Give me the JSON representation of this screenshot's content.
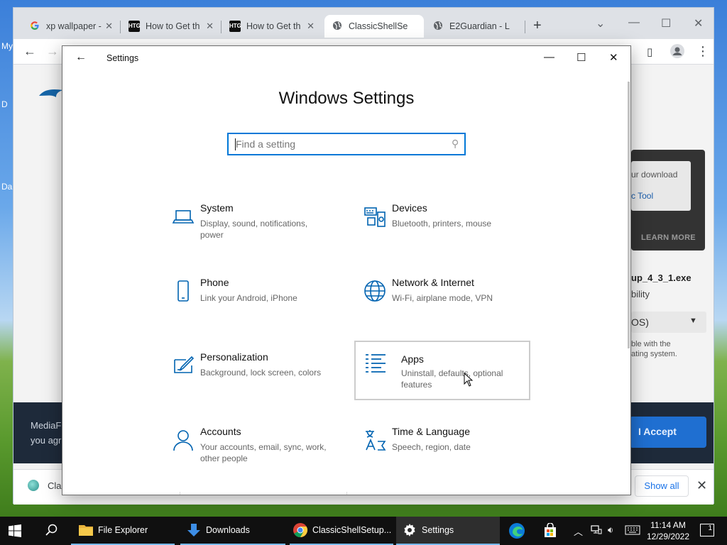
{
  "desktop": {
    "strip_texts": [
      "My",
      "D",
      "Da"
    ]
  },
  "browser": {
    "tabs": [
      {
        "label": "xp wallpaper -",
        "icon": "google-icon"
      },
      {
        "label": "How to Get th",
        "icon": "htg-icon"
      },
      {
        "label": "How to Get th",
        "icon": "htg-icon"
      },
      {
        "label": "ClassicShellSe",
        "icon": "globe-icon"
      },
      {
        "label": "E2Guardian - L",
        "icon": "globe-icon"
      }
    ],
    "htg_badge": "HTG",
    "page": {
      "ad_text": "ur download",
      "ad_link": "c Tool",
      "learn_more": "LEARN MORE",
      "download_name": "up_4_3_1.exe",
      "download_sub": "bility",
      "os_select": "OS)",
      "note_line1": "ble with the",
      "note_line2": "ating system.",
      "consent_line1": "MediaF",
      "consent_line2": "you agr",
      "accept_label": "I Accept"
    },
    "download_bar": {
      "file_label": "Clas",
      "show_all": "Show all"
    }
  },
  "settings": {
    "title": "Settings",
    "heading": "Windows Settings",
    "search_placeholder": "Find a setting",
    "tiles": [
      {
        "name": "System",
        "desc": "Display, sound, notifications, power",
        "icon": "laptop-icon"
      },
      {
        "name": "Devices",
        "desc": "Bluetooth, printers, mouse",
        "icon": "devices-icon"
      },
      {
        "name": "Phone",
        "desc": "Link your Android, iPhone",
        "icon": "phone-icon"
      },
      {
        "name": "Network & Internet",
        "desc": "Wi-Fi, airplane mode, VPN",
        "icon": "globe-icon"
      },
      {
        "name": "Personalization",
        "desc": "Background, lock screen, colors",
        "icon": "paint-icon"
      },
      {
        "name": "Apps",
        "desc": "Uninstall, defaults, optional features",
        "icon": "apps-list-icon"
      },
      {
        "name": "Accounts",
        "desc": "Your accounts, email, sync, work, other people",
        "icon": "person-icon"
      },
      {
        "name": "Time & Language",
        "desc": "Speech, region, date",
        "icon": "time-language-icon"
      }
    ]
  },
  "taskbar": {
    "apps": [
      {
        "label": "File Explorer",
        "icon": "folder-icon"
      },
      {
        "label": "Downloads",
        "icon": "download-arrow-icon"
      },
      {
        "label": "ClassicShellSetup...",
        "icon": "chrome-icon"
      },
      {
        "label": "Settings",
        "icon": "gear-icon"
      }
    ],
    "clock": {
      "time": "11:14 AM",
      "date": "12/29/2022"
    },
    "notification_count": "1"
  },
  "colors": {
    "accent": "#0078d7",
    "taskbar": "#101010",
    "icon_blue": "#0063b1"
  }
}
